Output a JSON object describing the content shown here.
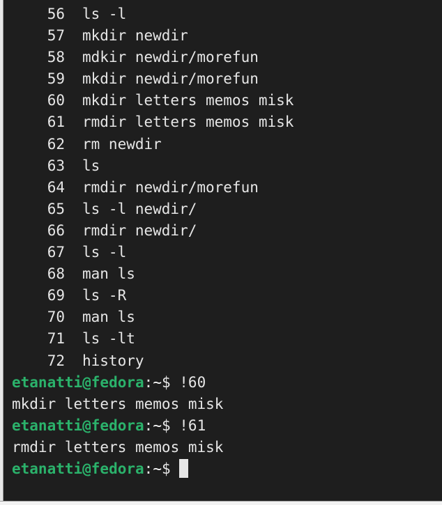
{
  "terminal": {
    "history": [
      {
        "num": "56",
        "cmd": "ls -l"
      },
      {
        "num": "57",
        "cmd": "mkdir newdir"
      },
      {
        "num": "58",
        "cmd": "mdkir newdir/morefun"
      },
      {
        "num": "59",
        "cmd": "mkdir newdir/morefun"
      },
      {
        "num": "60",
        "cmd": "mkdir letters memos misk"
      },
      {
        "num": "61",
        "cmd": "rmdir letters memos misk"
      },
      {
        "num": "62",
        "cmd": "rm newdir"
      },
      {
        "num": "63",
        "cmd": "ls"
      },
      {
        "num": "64",
        "cmd": "rmdir newdir/morefun"
      },
      {
        "num": "65",
        "cmd": "ls -l newdir/"
      },
      {
        "num": "66",
        "cmd": "rmdir newdir/"
      },
      {
        "num": "67",
        "cmd": "ls -l"
      },
      {
        "num": "68",
        "cmd": "man ls"
      },
      {
        "num": "69",
        "cmd": "ls -R"
      },
      {
        "num": "70",
        "cmd": "man ls"
      },
      {
        "num": "71",
        "cmd": "ls -lt"
      },
      {
        "num": "72",
        "cmd": "history"
      }
    ],
    "prompt": {
      "user_host": "etanatti@fedora",
      "colon": ":",
      "path": "~",
      "dollar": "$"
    },
    "session": [
      {
        "command": "!60",
        "output": "mkdir letters memos misk"
      },
      {
        "command": "!61",
        "output": "rmdir letters memos misk"
      }
    ],
    "colors": {
      "background": "#1e1e1e",
      "text": "#e6e6e6",
      "prompt_user": "#2bb26b"
    }
  }
}
